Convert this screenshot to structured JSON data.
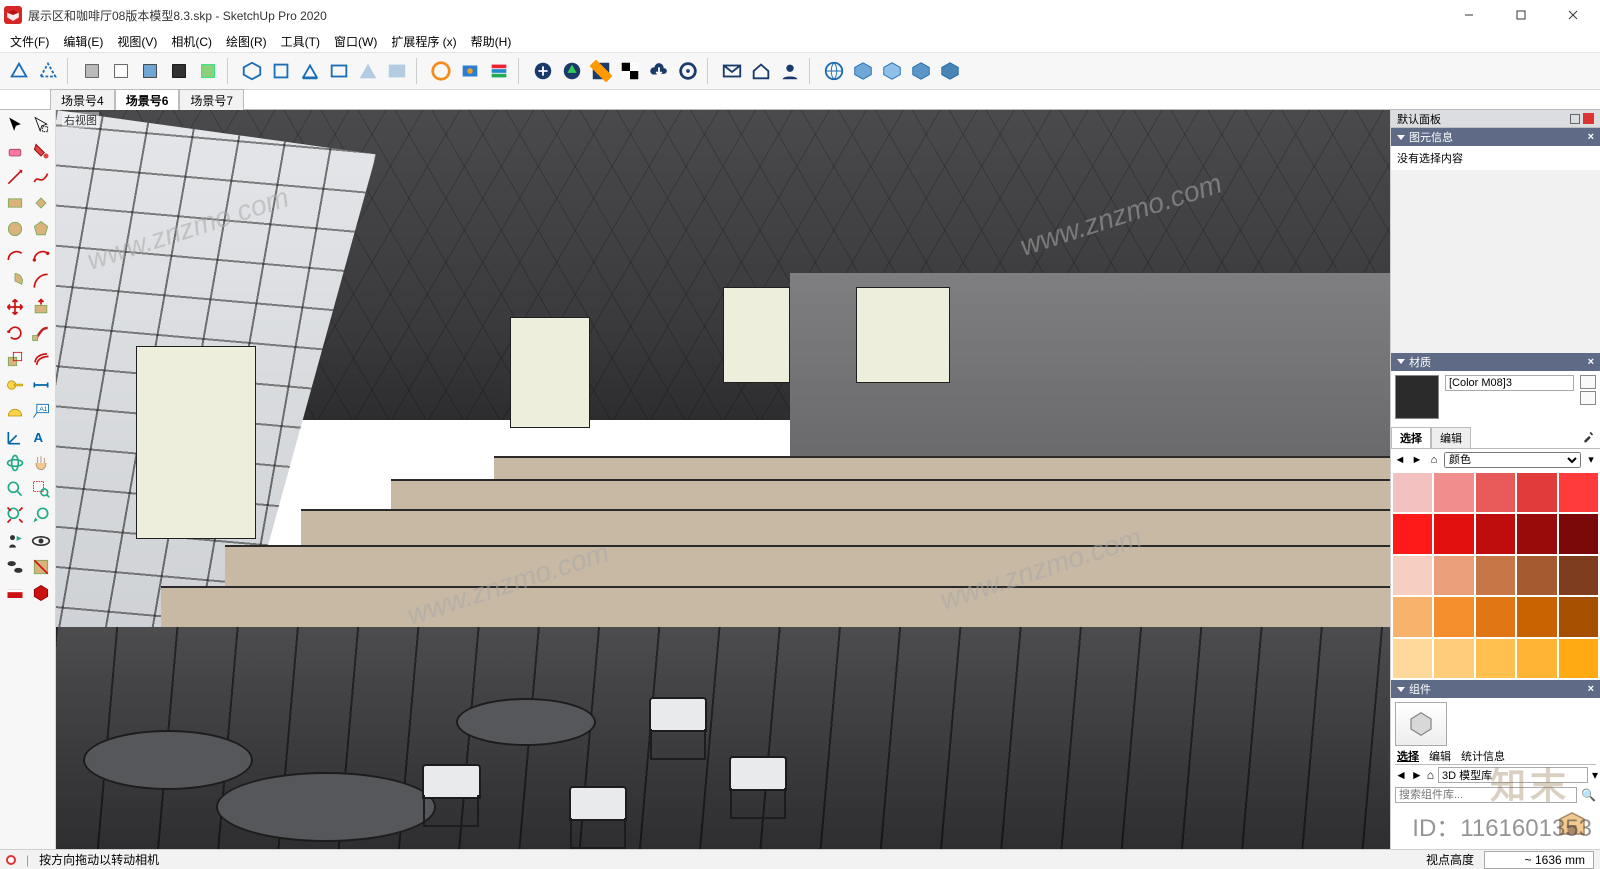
{
  "window": {
    "file_name": "展示区和咖啡厅08版本模型8.3.skp",
    "app_name": "SketchUp Pro 2020",
    "title_sep": " - "
  },
  "win_controls": {
    "min": "—",
    "max": "▢",
    "close": "✕"
  },
  "menu": {
    "items": [
      "文件(F)",
      "编辑(E)",
      "视图(V)",
      "相机(C)",
      "绘图(R)",
      "工具(T)",
      "窗口(W)",
      "扩展程序 (x)",
      "帮助(H)"
    ]
  },
  "scene_tabs": {
    "items": [
      {
        "label": "场景号4",
        "active": false
      },
      {
        "label": "场景号6",
        "active": true
      },
      {
        "label": "场景号7",
        "active": false
      }
    ]
  },
  "viewport": {
    "top_left_label": "右视图",
    "watermarks": [
      "www.znzmo.com",
      "www.znzmo.com",
      "www.znzmo.com",
      "www.znzmo.com"
    ]
  },
  "trays": {
    "default_tray_title": "默认面板",
    "entity_info": {
      "title": "图元信息",
      "body": "没有选择内容"
    },
    "materials": {
      "title": "材质",
      "current_name": "[Color M08]3",
      "tabs": [
        "选择",
        "编辑"
      ],
      "active_tab": "选择",
      "library_label": "颜色",
      "swatches": [
        "#f4c1c1",
        "#f08d8d",
        "#e85a5a",
        "#e23b3b",
        "#ff3b3b",
        "#ff1a1a",
        "#e20f0f",
        "#bf0d0d",
        "#990a0a",
        "#7a0808",
        "#f7cfc2",
        "#e9a07a",
        "#c77648",
        "#a65a2f",
        "#7f3d1f",
        "#f7b36b",
        "#f58f2e",
        "#e07714",
        "#c96200",
        "#a64f00",
        "#ffd89b",
        "#ffcc7a",
        "#ffc04f",
        "#ffb433",
        "#ffa913"
      ]
    },
    "components": {
      "title": "组件",
      "tabs": [
        "选择",
        "编辑",
        "统计信息"
      ],
      "active_tab": "选择",
      "library_label": "3D 模型库",
      "search_placeholder": "搜索组件库..."
    }
  },
  "status": {
    "hint": "按方向拖动以转动相机",
    "measure_label": "视点高度",
    "measure_value": "~ 1636 mm"
  },
  "overlay": {
    "id_text": "ID：1161601353",
    "brand_text": "知末"
  }
}
